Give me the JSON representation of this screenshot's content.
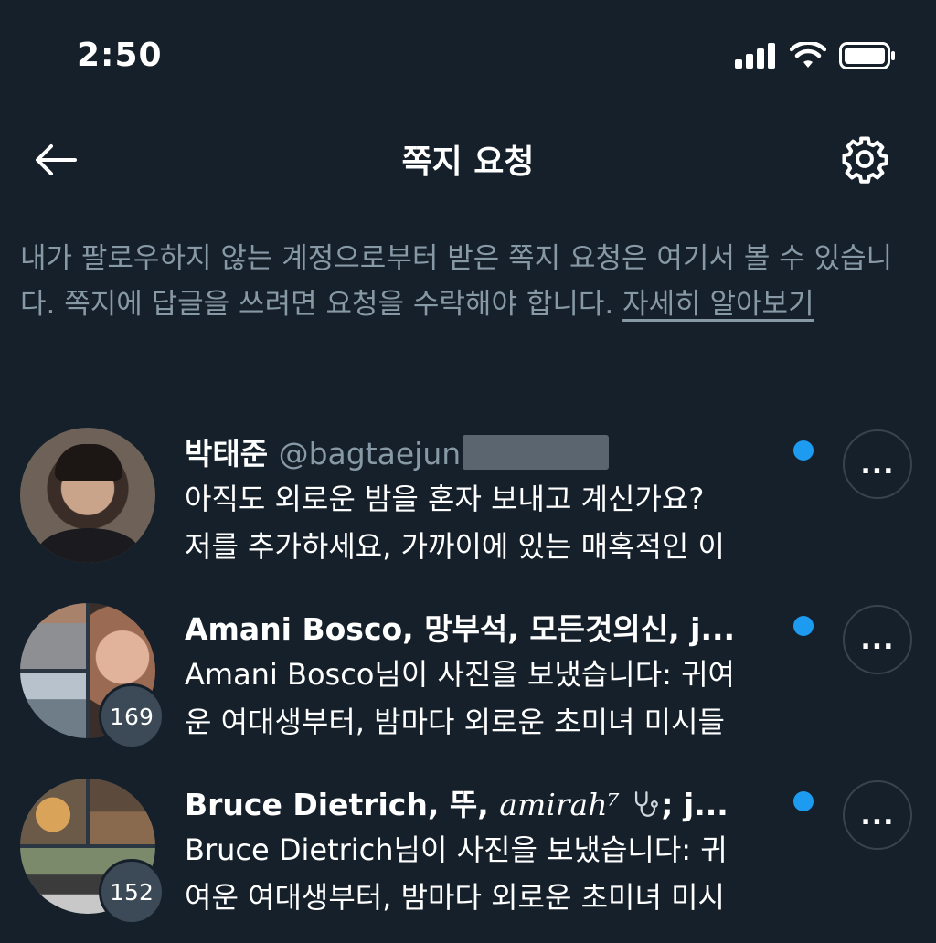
{
  "status_bar": {
    "time": "2:50",
    "icons": [
      "cellular-signal-icon",
      "wifi-icon",
      "battery-icon"
    ]
  },
  "header": {
    "title": "쪽지 요청",
    "back_icon": "arrow-left-icon",
    "settings_icon": "gear-icon"
  },
  "intro": {
    "text": "내가 팔로우하지 않는 계정으로부터 받은 쪽지 요청은 여기서 볼 수 있습니다. 쪽지에 답글을 쓰려면 요청을 수락해야 합니다. ",
    "link": "자세히 알아보기"
  },
  "requests": [
    {
      "name": "박태준",
      "handle": "@bagtaejun",
      "message_line1": "아직도 외로운 밤을 혼자 보내고 계신가요?",
      "message_line2": "저를 추가하세요, 가까이에 있는 매혹적인 이",
      "unread": true
    },
    {
      "name": "Amani Bosco, 망부석, 모든것의신, j...",
      "message_line1": "Amani Bosco님이 사진을 보냈습니다: 귀여",
      "message_line2": "운 여대생부터, 밤마다 외로운 초미녀 미시들",
      "count": "169",
      "unread": true
    },
    {
      "name_prefix": "Bruce Dietrich, 뚜, ",
      "name_script": "amirah⁷",
      "name_suffix": "; j...",
      "message_line1": "Bruce Dietrich님이 사진을 보냈습니다: 귀",
      "message_line2": "여운 여대생부터, 밤마다 외로운 초미녀 미시",
      "count": "152",
      "unread": true
    }
  ],
  "more_label": "...",
  "colors": {
    "background": "#15202b",
    "accent": "#1d9bf0",
    "secondary_text": "#8899a6"
  }
}
